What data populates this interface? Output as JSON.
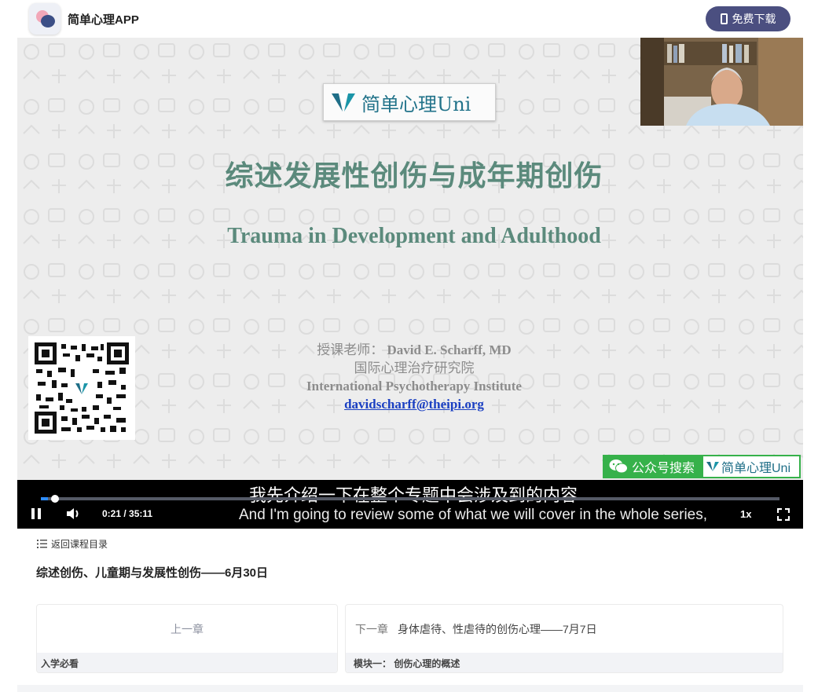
{
  "header": {
    "app_name": "简单心理APP",
    "download_label": "免费下载"
  },
  "slide": {
    "brand": "简单心理Uni",
    "title_cn": "综述发展性创伤与成年期创伤",
    "title_en": "Trauma in Development and Adulthood",
    "teacher_label": "授课老师：",
    "teacher_name": "David E. Scharff, MD",
    "institute_cn": "国际心理治疗研究院",
    "institute_en": "International Psychotherapy Institute",
    "email": "davidscharff@theipi.org",
    "wechat_search": "公众号搜索",
    "wechat_brand": "简单心理Uni"
  },
  "player": {
    "subtitle_cn": "我先介绍一下在整个专题中会涉及到的内容",
    "subtitle_en": "And I'm going to review some of what we will cover in the whole series,",
    "time": "0:21 / 35:11",
    "progress": 0.01,
    "speed": "1x"
  },
  "course": {
    "back_label": "返回课程目录",
    "title": "综述创伤、儿童期与发展性创伤——6月30日"
  },
  "chapters": {
    "prev_label": "上一章",
    "prev_module": "入学必看",
    "next_label": "下一章",
    "next_title": "身体虐待、性虐待的创伤心理——7月7日",
    "next_module": "模块一： 创伤心理的概述"
  },
  "colors": {
    "accent": "#4b4f80",
    "slide_title": "#5b8a7c",
    "wechat_green": "#36b14a",
    "progress_blue": "#2e8cff"
  }
}
